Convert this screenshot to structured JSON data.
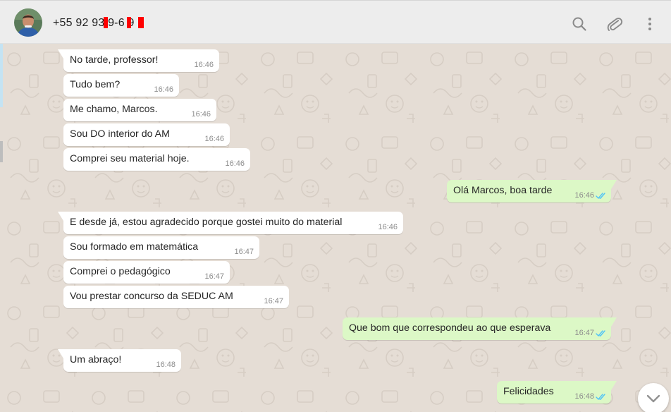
{
  "header": {
    "contact_name": "+55 92 93  9-6  9",
    "avatar_icon": "avatar-photo",
    "search_icon": "search-icon",
    "attach_icon": "paperclip-icon",
    "menu_icon": "more-vertical-icon"
  },
  "colors": {
    "header_bg": "#ededed",
    "chat_bg": "#e5ddd5",
    "incoming_bubble": "#ffffff",
    "outgoing_bubble": "#dcf8c6",
    "read_ticks": "#4fc3f7",
    "redaction": "#ff0000"
  },
  "messages": [
    {
      "dir": "in",
      "text": "No tarde, professor!",
      "time": "16:46"
    },
    {
      "dir": "in",
      "text": "Tudo bem?",
      "time": "16:46"
    },
    {
      "dir": "in",
      "text": "Me chamo, Marcos.",
      "time": "16:46"
    },
    {
      "dir": "in",
      "text": "Sou DO interior do AM",
      "time": "16:46"
    },
    {
      "dir": "in",
      "text": "Comprei seu material hoje.",
      "time": "16:46"
    },
    {
      "dir": "out",
      "text": "Olá Marcos, boa tarde",
      "time": "16:46",
      "status": "read"
    },
    {
      "dir": "in",
      "text": "E desde já, estou agradecido porque gostei muito do material",
      "time": "16:46"
    },
    {
      "dir": "in",
      "text": "Sou formado em matemática",
      "time": "16:47"
    },
    {
      "dir": "in",
      "text": "Comprei o pedagógico",
      "time": "16:47"
    },
    {
      "dir": "in",
      "text": "Vou prestar concurso da SEDUC AM",
      "time": "16:47"
    },
    {
      "dir": "out",
      "text": "Que bom que correspondeu ao que esperava",
      "time": "16:47",
      "status": "read"
    },
    {
      "dir": "in",
      "text": "Um abraço!",
      "time": "16:48"
    },
    {
      "dir": "out",
      "text": "Felicidades",
      "time": "16:48",
      "status": "read"
    }
  ],
  "scroll_button_icon": "chevron-down-icon"
}
